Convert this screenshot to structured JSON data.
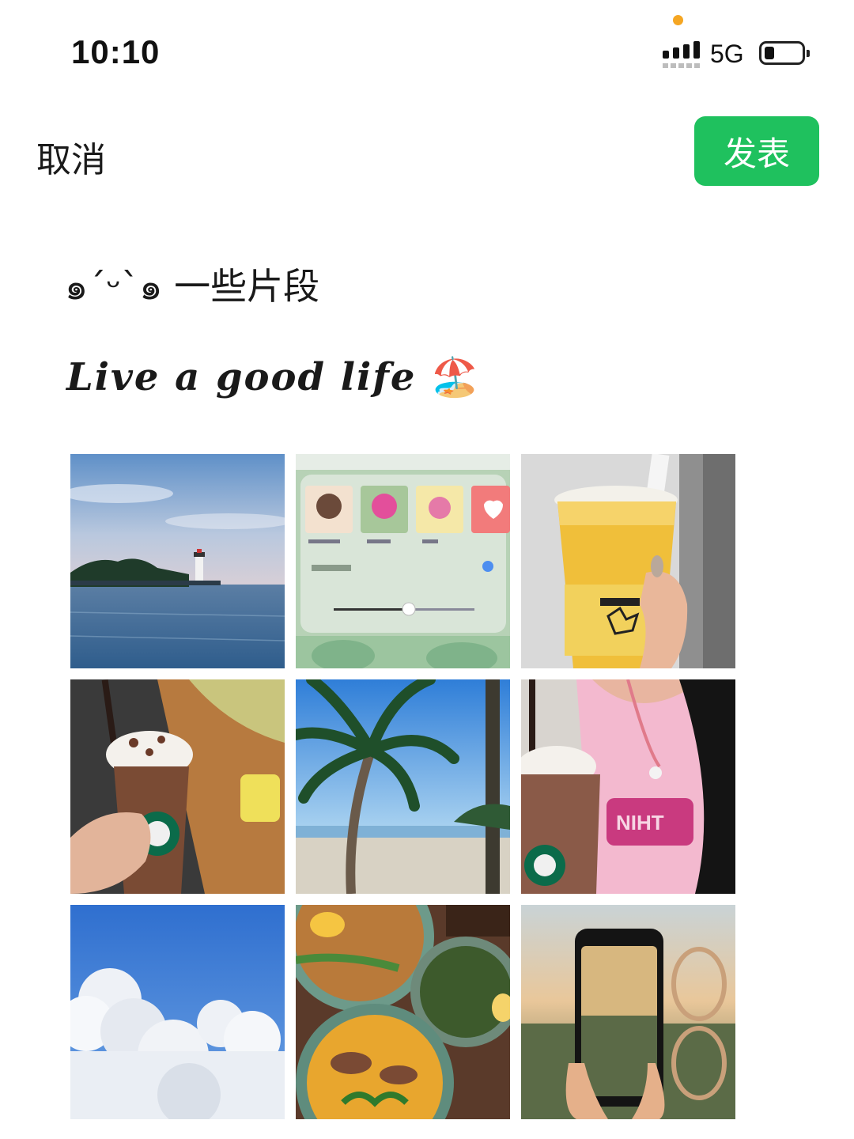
{
  "status_bar": {
    "time": "10:10",
    "network": "5G",
    "icons": [
      "mic-indicator-dot",
      "signal-bars-icon",
      "battery-icon"
    ]
  },
  "header": {
    "cancel_label": "取消",
    "publish_label": "发表",
    "accent_color": "#1fc15e"
  },
  "post": {
    "line1_emoticon": "๑´ᵕ`๑",
    "line1_text": "一些片段",
    "line2_text": "Live a good life",
    "line2_emoji": "🏖️"
  },
  "photos": [
    {
      "name": "photo-lighthouse-sea"
    },
    {
      "name": "photo-music-widget"
    },
    {
      "name": "photo-mango-drink"
    },
    {
      "name": "photo-starbucks-frappuccino-table"
    },
    {
      "name": "photo-palm-tree-beach"
    },
    {
      "name": "photo-starbucks-frappuccino-pink-shirt"
    },
    {
      "name": "photo-clouds-sky"
    },
    {
      "name": "photo-food-bowls"
    },
    {
      "name": "photo-phone-sunset"
    }
  ]
}
